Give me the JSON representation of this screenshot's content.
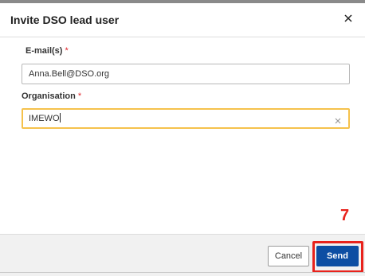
{
  "dialog": {
    "title": "Invite DSO lead user",
    "fields": {
      "email": {
        "label": "E-mail(s)",
        "required_mark": "*",
        "value": "Anna.Bell@DSO.org"
      },
      "organisation": {
        "label": "Organisation",
        "required_mark": "*",
        "value": "IMEWO"
      }
    },
    "step_marker": "7",
    "buttons": {
      "cancel": "Cancel",
      "send": "Send"
    }
  },
  "colors": {
    "primary": "#0d4ea3",
    "focus_border": "#f5c24c",
    "required": "#e0282e",
    "highlight": "#e8221c"
  }
}
